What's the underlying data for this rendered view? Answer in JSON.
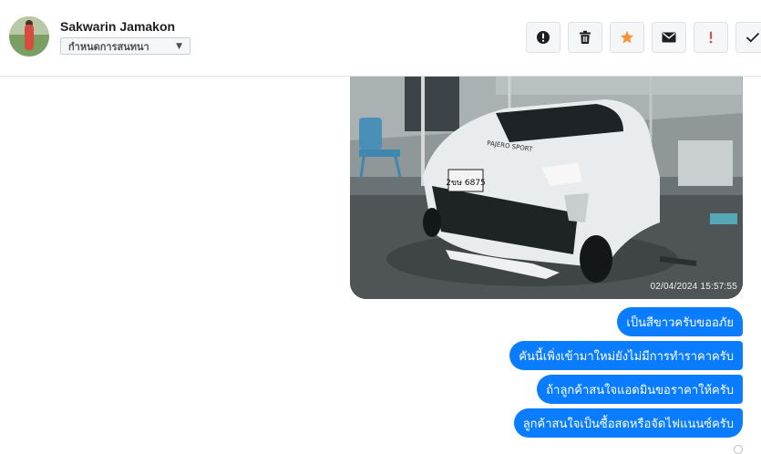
{
  "header": {
    "user_name": "Sakwarin Jamakon",
    "assign_label": "กำหนดการสนทนา",
    "actions": [
      {
        "name": "alert-circle",
        "color": "#1c1e21"
      },
      {
        "name": "trash",
        "color": "#1c1e21"
      },
      {
        "name": "star",
        "color": "#f7923b"
      },
      {
        "name": "mail",
        "color": "#1c1e21"
      },
      {
        "name": "exclamation",
        "color": "#fa3e3e"
      },
      {
        "name": "check",
        "color": "#1c1e21"
      }
    ]
  },
  "photo": {
    "timestamp": "02/04/2024 15:57:55",
    "plate": "2ขษ 6875",
    "badge": "PAJERO SPORT"
  },
  "messages": [
    {
      "text": "เป็นสีขาวครับขออภัย"
    },
    {
      "text": "คันนี้เพิ่งเข้ามาใหม่ยังไม่มีการทำราคาครับ"
    },
    {
      "text": "ถ้าลูกค้าสนใจแอดมินขอราคาให้ครับ"
    },
    {
      "text": "ลูกค้าสนใจเป็นซื้อสดหรือจัดไฟแนนซ์ครับ"
    }
  ],
  "colors": {
    "bubble": "#0a7cff",
    "divider": "#dddfe2"
  }
}
